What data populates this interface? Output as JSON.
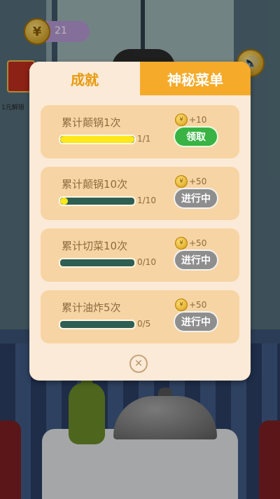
{
  "hud": {
    "coins": "21",
    "coin_icon": "yuan-coin-icon",
    "gift_label": "1元解锁",
    "sound_icon": "speaker-icon"
  },
  "modal": {
    "tabs": [
      {
        "label": "成就",
        "active": true
      },
      {
        "label": "神秘菜单",
        "active": false
      }
    ],
    "achievements": [
      {
        "title": "累计颠锅1次",
        "reward": "+10",
        "progress_text": "1/1",
        "progress": 1.0,
        "button": "领取",
        "button_state": "claim"
      },
      {
        "title": "累计颠锅10次",
        "reward": "+50",
        "progress_text": "1/10",
        "progress": 0.1,
        "button": "进行中",
        "button_state": "in-progress"
      },
      {
        "title": "累计切菜10次",
        "reward": "+50",
        "progress_text": "0/10",
        "progress": 0.0,
        "button": "进行中",
        "button_state": "in-progress"
      },
      {
        "title": "累计油炸5次",
        "reward": "+50",
        "progress_text": "0/5",
        "progress": 0.0,
        "button": "进行中",
        "button_state": "in-progress"
      }
    ],
    "close_icon": "close-icon"
  },
  "colors": {
    "tab_active_text": "#e89a0f",
    "tab_inactive_bg": "#f5aa2a",
    "card_bg": "#f7d4a3",
    "claim_button": "#38b344",
    "progress_button": "#8e8e8e",
    "bar_fill": "#ffe81b"
  }
}
